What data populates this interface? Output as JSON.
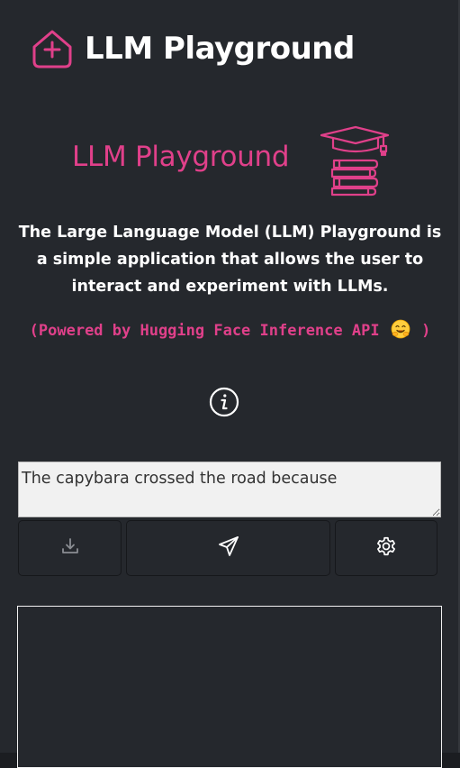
{
  "header": {
    "title": "LLM Playground",
    "logo_icon": "home-plus-icon"
  },
  "hero": {
    "title": "LLM Playground",
    "icon": "graduation-cap-books-icon"
  },
  "description": "The Large Language Model (LLM) Playground is a simple application that allows the user to interact and experiment with LLMs.",
  "powered_by": {
    "prefix": "(Powered by Hugging Face Inference API",
    "suffix": ")",
    "emoji_icon": "hugging-face-emoji-icon"
  },
  "info_button": {
    "icon": "info-icon"
  },
  "prompt": {
    "value": "The capybara crossed the road because"
  },
  "toolbar": {
    "download_icon": "download-icon",
    "send_icon": "send-icon",
    "settings_icon": "gear-icon"
  },
  "colors": {
    "accent": "#e0408a",
    "background": "#25282d",
    "text": "#ffffff"
  }
}
